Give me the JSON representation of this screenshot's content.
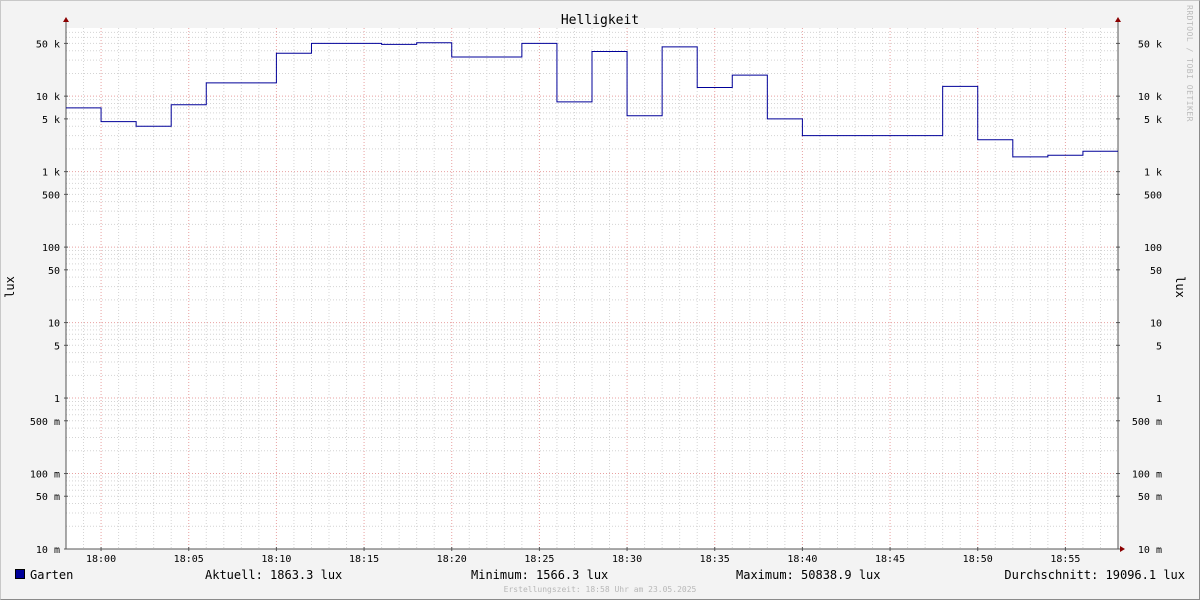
{
  "chart_data": {
    "type": "line",
    "title": "Helligkeit",
    "ylabel": "lux",
    "yscale": "log",
    "ylim": [
      0.01,
      80000
    ],
    "xlim": [
      "17:58",
      "18:58"
    ],
    "x_ticks": [
      "18:00",
      "18:05",
      "18:10",
      "18:15",
      "18:20",
      "18:25",
      "18:30",
      "18:35",
      "18:40",
      "18:45",
      "18:50",
      "18:55"
    ],
    "y_ticks": [
      {
        "value": 50000,
        "label": "50 k"
      },
      {
        "value": 10000,
        "label": "10 k"
      },
      {
        "value": 5000,
        "label": "5 k"
      },
      {
        "value": 1000,
        "label": "1 k"
      },
      {
        "value": 500,
        "label": "500"
      },
      {
        "value": 100,
        "label": "100"
      },
      {
        "value": 50,
        "label": "50"
      },
      {
        "value": 10,
        "label": "10"
      },
      {
        "value": 5,
        "label": "5"
      },
      {
        "value": 1,
        "label": "1"
      },
      {
        "value": 0.5,
        "label": "500 m"
      },
      {
        "value": 0.1,
        "label": "100 m"
      },
      {
        "value": 0.05,
        "label": "50 m"
      },
      {
        "value": 0.01,
        "label": "10 m"
      }
    ],
    "grid": true,
    "legend_position": "bottom-left",
    "series": [
      {
        "name": "Garten",
        "color": "#000099",
        "step": true,
        "x": [
          "17:58",
          "18:00",
          "18:02",
          "18:04",
          "18:06",
          "18:08",
          "18:10",
          "18:12",
          "18:14",
          "18:16",
          "18:18",
          "18:20",
          "18:22",
          "18:24",
          "18:26",
          "18:28",
          "18:30",
          "18:32",
          "18:34",
          "18:36",
          "18:38",
          "18:40",
          "18:42",
          "18:44",
          "18:46",
          "18:48",
          "18:50",
          "18:52",
          "18:54",
          "18:56"
        ],
        "values": [
          7000,
          4600,
          4000,
          7700,
          15000,
          15000,
          37000,
          50000,
          50000,
          48500,
          51000,
          33000,
          33000,
          50000,
          8400,
          39000,
          5500,
          45000,
          13000,
          19000,
          5000,
          3000,
          3000,
          3000,
          3000,
          13500,
          2650,
          1566.3,
          1650,
          1863.3
        ]
      }
    ]
  },
  "legend": {
    "series_name": "Garten",
    "series_color": "#000099",
    "current": "Aktuell: 1863.3 lux",
    "minimum": "Minimum: 1566.3 lux",
    "maximum": "Maximum: 50838.9 lux",
    "average": "Durchschnitt: 19096.1 lux"
  },
  "watermark": "RRDTOOL / TOBI OETIKER",
  "footer": "Erstellungszeit: 18:58 Uhr am 23.05.2025",
  "colors": {
    "background": "#f3f3f3",
    "canvas": "#ffffff",
    "grid_minor": "#d4d4d4",
    "grid_major": "#e8a0a0",
    "axis": "#555555",
    "arrow": "#8b0000",
    "series": "#000099"
  }
}
